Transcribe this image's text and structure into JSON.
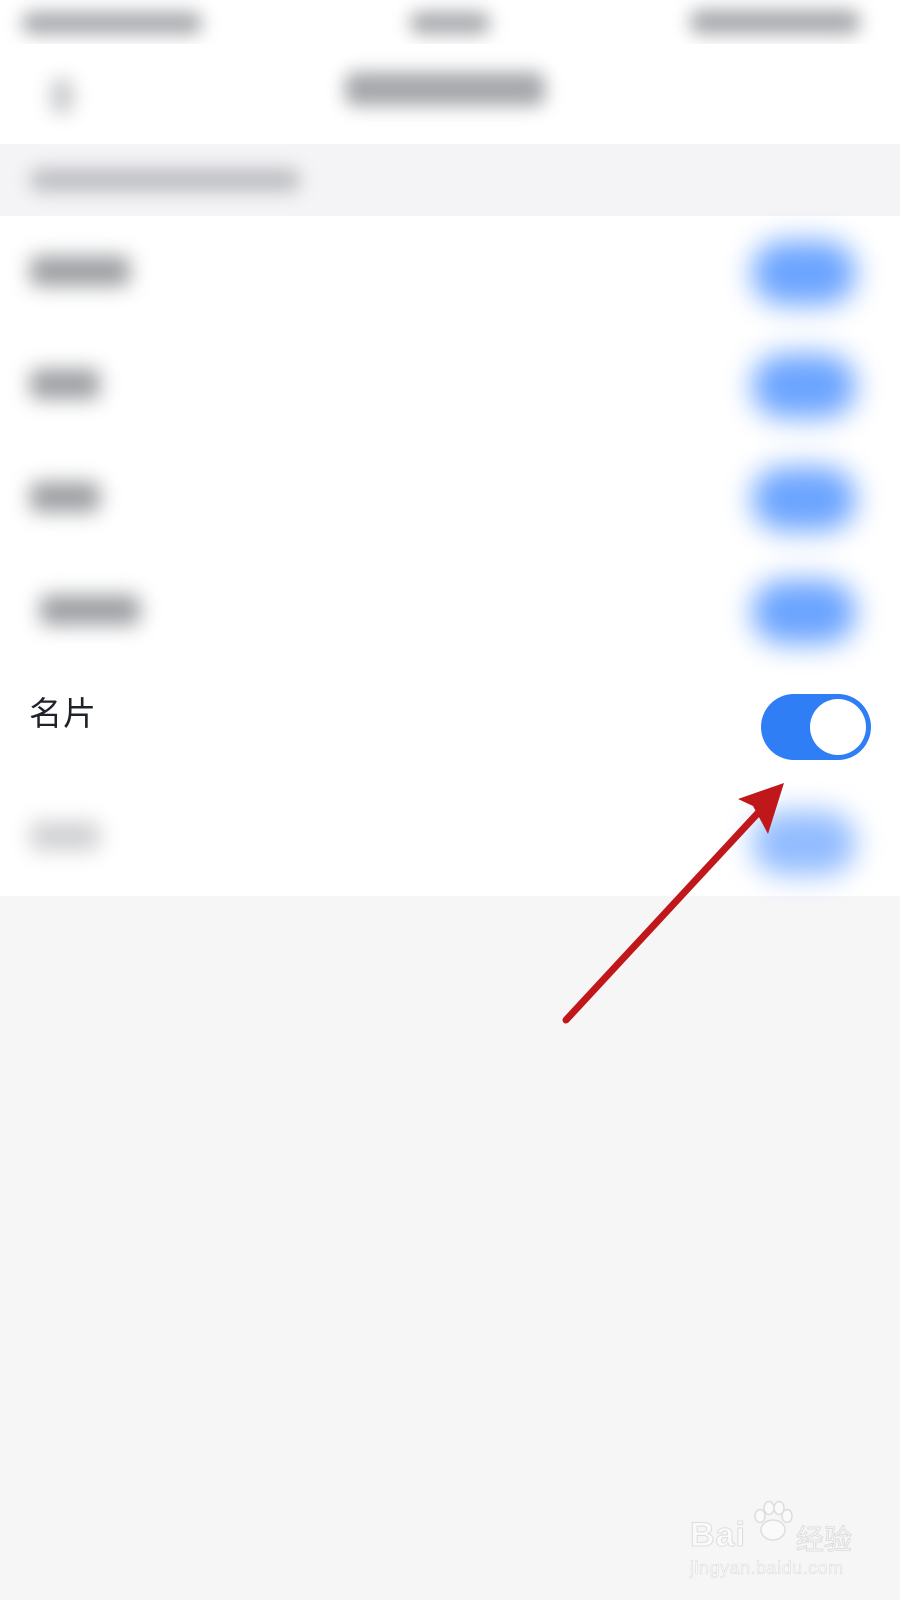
{
  "settings_row": {
    "label": "名片",
    "toggle_on": true
  },
  "watermark": {
    "brand_left": "Bai",
    "brand_right": "经验",
    "url": "jingyan.baidu.com"
  },
  "colors": {
    "toggle_on": "#2f7ef5",
    "arrow": "#c0181a",
    "background": "#f6f6f7"
  },
  "icons": {
    "annotation": "red-arrow-icon",
    "watermark_logo": "baidu-paw-icon"
  }
}
